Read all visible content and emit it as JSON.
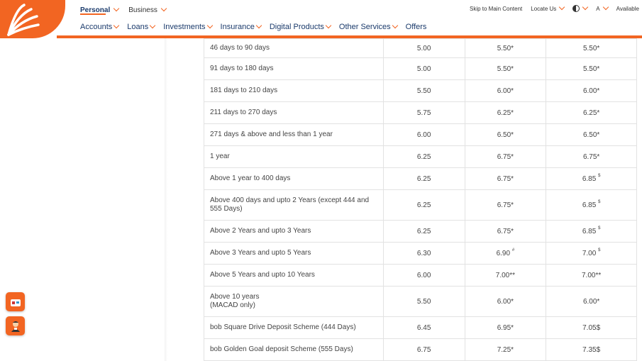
{
  "header": {
    "top_tabs": [
      {
        "label": "Personal",
        "active": true
      },
      {
        "label": "Business",
        "active": false
      }
    ],
    "utilities": {
      "skip": "Skip to Main Content",
      "locate": "Locate Us",
      "font": "A",
      "available": "Available"
    },
    "nav": [
      "Accounts",
      "Loans",
      "Investments",
      "Insurance",
      "Digital Products",
      "Other Services",
      "Offers"
    ]
  },
  "colors": {
    "accent": "#f26522",
    "nav_text": "#1a3a6b"
  },
  "table": {
    "rows": [
      {
        "period": "46 days to 90 days",
        "c1": "5.00",
        "c2": "5.50*",
        "c3": "5.50*",
        "c2_sup": "",
        "c3_sup": ""
      },
      {
        "period": "91 days to 180 days",
        "c1": "5.00",
        "c2": "5.50*",
        "c3": "5.50*",
        "c2_sup": "",
        "c3_sup": ""
      },
      {
        "period": "181 days to 210 days",
        "c1": "5.50",
        "c2": "6.00*",
        "c3": "6.00*",
        "c2_sup": "",
        "c3_sup": ""
      },
      {
        "period": "211 days to 270 days",
        "c1": "5.75",
        "c2": "6.25*",
        "c3": "6.25*",
        "c2_sup": "",
        "c3_sup": ""
      },
      {
        "period": "271 days & above and less than 1 year",
        "c1": "6.00",
        "c2": "6.50*",
        "c3": "6.50*",
        "c2_sup": "",
        "c3_sup": ""
      },
      {
        "period": "1 year",
        "c1": "6.25",
        "c2": "6.75*",
        "c3": "6.75*",
        "c2_sup": "",
        "c3_sup": ""
      },
      {
        "period": "Above 1 year to 400 days",
        "c1": "6.25",
        "c2": "6.75*",
        "c3": "6.85",
        "c2_sup": "",
        "c3_sup": "$"
      },
      {
        "period": "Above 400 days and upto 2 Years (except 444 and 555 Days)",
        "c1": "6.25",
        "c2": "6.75*",
        "c3": "6.85",
        "c2_sup": "",
        "c3_sup": "$"
      },
      {
        "period": "Above 2 Years and upto 3 Years",
        "c1": "6.25",
        "c2": "6.75*",
        "c3": "6.85",
        "c2_sup": "",
        "c3_sup": "$"
      },
      {
        "period": "Above 3 Years and upto 5 Years",
        "c1": "6.30",
        "c2": "6.90",
        "c3": "7.00",
        "c2_sup": "#",
        "c3_sup": "$"
      },
      {
        "period": "Above 5 Years and upto 10 Years",
        "c1": "6.00",
        "c2": "7.00**",
        "c3": "7.00**",
        "c2_sup": "",
        "c3_sup": ""
      },
      {
        "period": "Above 10 years (MACAD only)",
        "c1": "5.50",
        "c2": "6.00*",
        "c3": "6.00*",
        "c2_sup": "",
        "c3_sup": ""
      },
      {
        "period": "bob Square Drive Deposit Scheme (444 Days)",
        "c1": "6.45",
        "c2": "6.95*",
        "c3": "7.05$",
        "c2_sup": "",
        "c3_sup": ""
      },
      {
        "period": "bob Golden Goal deposit Scheme (555 Days)",
        "c1": "6.75",
        "c2": "7.25*",
        "c3": "7.35$",
        "c2_sup": "",
        "c3_sup": ""
      }
    ]
  }
}
